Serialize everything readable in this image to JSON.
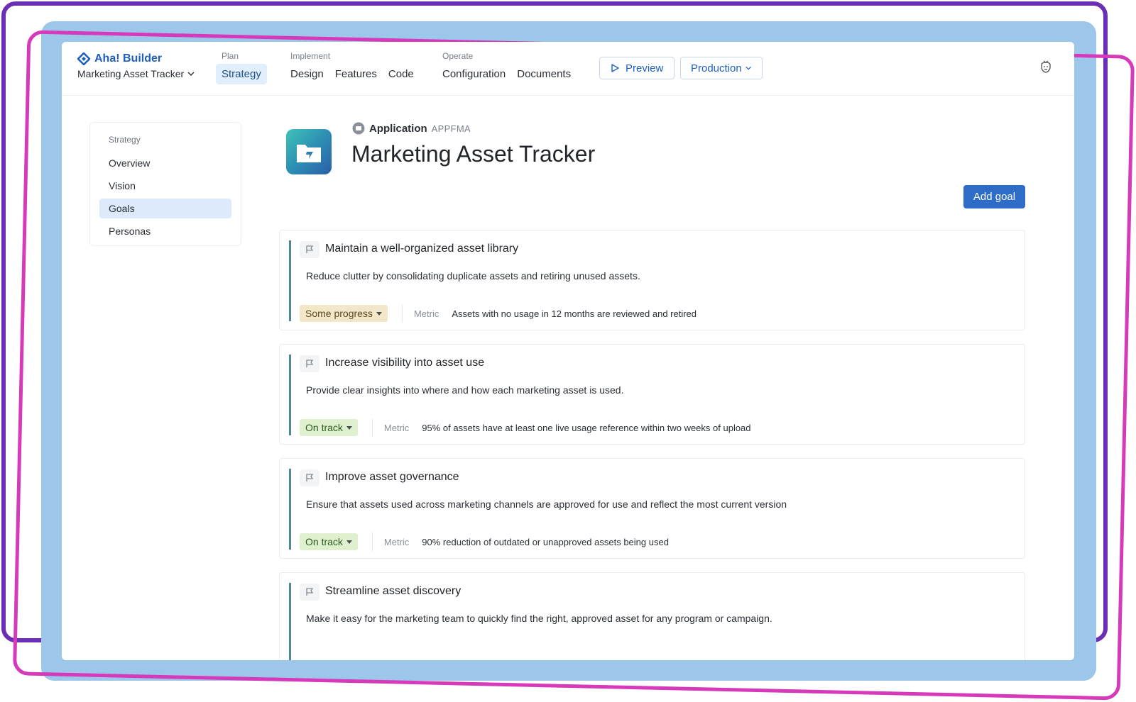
{
  "brand": {
    "name": "Aha! Builder",
    "app_name": "Marketing Asset Tracker"
  },
  "nav": {
    "groups": [
      {
        "label": "Plan",
        "items": [
          "Strategy"
        ]
      },
      {
        "label": "Implement",
        "items": [
          "Design",
          "Features",
          "Code"
        ]
      },
      {
        "label": "Operate",
        "items": [
          "Configuration",
          "Documents"
        ]
      }
    ],
    "active": "Strategy",
    "preview_label": "Preview",
    "environment_label": "Production"
  },
  "sidebar": {
    "heading": "Strategy",
    "items": [
      {
        "label": "Overview"
      },
      {
        "label": "Vision"
      },
      {
        "label": "Goals"
      },
      {
        "label": "Personas"
      }
    ],
    "active": "Goals"
  },
  "header": {
    "type_label": "Application",
    "type_key": "APPFMA",
    "title": "Marketing Asset Tracker",
    "add_goal_label": "Add goal"
  },
  "goals": [
    {
      "title": "Maintain a well-organized asset library",
      "description": "Reduce clutter by consolidating duplicate assets and retiring unused assets.",
      "status": "Some progress",
      "metric_label": "Metric",
      "metric": "Assets with no usage in 12 months are reviewed and retired"
    },
    {
      "title": "Increase visibility into asset use",
      "description": "Provide clear insights into where and how each marketing asset is used.",
      "status": "On track",
      "metric_label": "Metric",
      "metric": "95% of assets have at least one live usage reference within two weeks of upload"
    },
    {
      "title": "Improve asset governance",
      "description": "Ensure that assets used across marketing channels are approved for use and reflect the most current version",
      "status": "On track",
      "metric_label": "Metric",
      "metric": "90% reduction of outdated or unapproved assets being used"
    },
    {
      "title": "Streamline asset discovery",
      "description": "Make it easy for the marketing team to quickly find the right, approved asset for any program or campaign."
    }
  ],
  "colors": {
    "frame_purple": "#6a2fb5",
    "frame_pink": "#d63aba",
    "frame_blue": "#9dc7ea",
    "primary": "#2d6cc7",
    "status_some_progress": "#f3e7c9",
    "status_on_track": "#dff0cf"
  },
  "icons": [
    "brand-logo-icon",
    "chevron-down-icon",
    "play-icon",
    "user-feedback-icon",
    "application-icon",
    "flag-icon"
  ]
}
